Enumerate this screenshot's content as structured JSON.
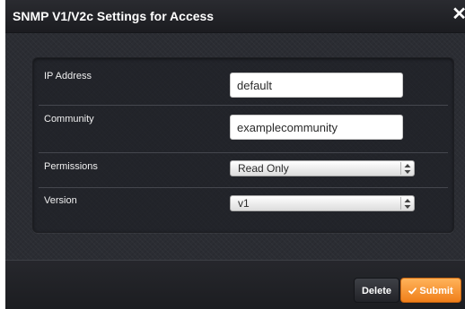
{
  "dialog": {
    "title": "SNMP V1/V2c Settings for Access",
    "close_label": "✕"
  },
  "form": {
    "ip_address": {
      "label": "IP Address",
      "value": "default"
    },
    "community": {
      "label": "Community",
      "value": "examplecommunity"
    },
    "permissions": {
      "label": "Permissions",
      "value": "Read Only"
    },
    "version": {
      "label": "Version",
      "value": "v1"
    }
  },
  "footer": {
    "delete_label": "Delete",
    "submit_label": "Submit"
  },
  "colors": {
    "accent": "#f28a22",
    "dialog_bg": "#2b2d33",
    "titlebar_bg": "#1e1f23"
  },
  "icons": {
    "close": "close-icon",
    "check": "check-icon",
    "select_arrows": "updown-arrows-icon"
  }
}
